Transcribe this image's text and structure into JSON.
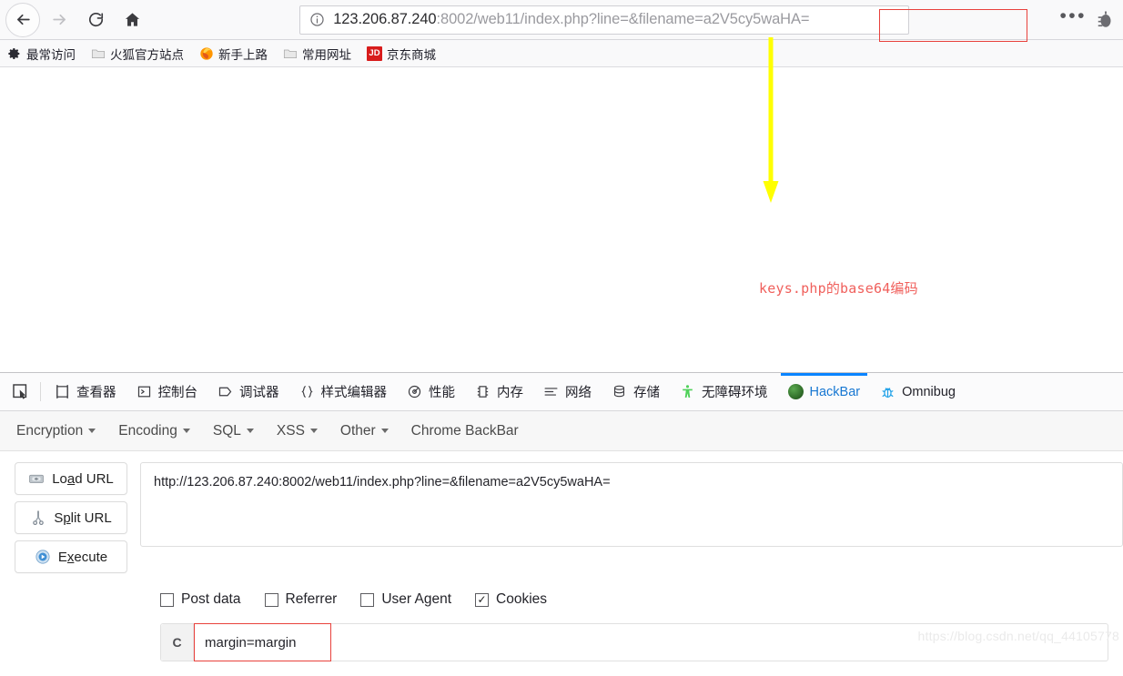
{
  "browser": {
    "nav": {
      "back_label": "Back",
      "forward_label": "Forward",
      "reload_label": "Reload",
      "home_label": "Home"
    },
    "url": {
      "host": "123.206.87.240",
      "path": ":8002/web11/index.php?line=&filename=",
      "highlighted": "a2V5cy5waHA=",
      "full": "123.206.87.240:8002/web11/index.php?line=&filename=a2V5cy5waHA="
    },
    "menu_label": "•••",
    "bookmarks": [
      {
        "label": "最常访问",
        "icon": "gear-icon"
      },
      {
        "label": "火狐官方站点",
        "icon": "folder-icon"
      },
      {
        "label": "新手上路",
        "icon": "firefox-icon"
      },
      {
        "label": "常用网址",
        "icon": "folder-icon"
      },
      {
        "label": "京东商城",
        "icon": "jd-icon",
        "badge": "JD"
      }
    ]
  },
  "annotation": {
    "text": "keys.php的base64编码",
    "color": "#f0605c",
    "arrow_color": "#ffff00"
  },
  "devtools": {
    "picker_label": "Element picker",
    "tabs": [
      {
        "label": "查看器",
        "icon": "inspector-icon",
        "active": false
      },
      {
        "label": "控制台",
        "icon": "console-icon",
        "active": false
      },
      {
        "label": "调试器",
        "icon": "debugger-icon",
        "active": false
      },
      {
        "label": "样式编辑器",
        "icon": "braces-icon",
        "active": false
      },
      {
        "label": "性能",
        "icon": "performance-icon",
        "active": false
      },
      {
        "label": "内存",
        "icon": "memory-icon",
        "active": false
      },
      {
        "label": "网络",
        "icon": "network-icon",
        "active": false
      },
      {
        "label": "存储",
        "icon": "storage-icon",
        "active": false
      },
      {
        "label": "无障碍环境",
        "icon": "accessibility-icon",
        "active": false
      },
      {
        "label": "HackBar",
        "icon": "hackbar-icon",
        "active": true
      },
      {
        "label": "Omnibug",
        "icon": "bug-icon",
        "active": false
      }
    ]
  },
  "hackbar": {
    "menus": [
      {
        "label": "Encryption",
        "has_caret": true
      },
      {
        "label": "Encoding",
        "has_caret": true
      },
      {
        "label": "SQL",
        "has_caret": true
      },
      {
        "label": "XSS",
        "has_caret": true
      },
      {
        "label": "Other",
        "has_caret": true
      },
      {
        "label": "Chrome BackBar",
        "has_caret": false
      }
    ],
    "buttons": [
      {
        "pre": "Lo",
        "key": "a",
        "post": "d URL",
        "icon": "load-url-icon"
      },
      {
        "pre": "S",
        "key": "p",
        "post": "lit URL",
        "icon": "split-url-icon"
      },
      {
        "pre": "E",
        "key": "x",
        "post": "ecute",
        "icon": "execute-icon"
      }
    ],
    "url_value": "http://123.206.87.240:8002/web11/index.php?line=&filename=a2V5cy5waHA=",
    "checkboxes": [
      {
        "label": "Post data",
        "checked": false
      },
      {
        "label": "Referrer",
        "checked": false
      },
      {
        "label": "User Agent",
        "checked": false
      },
      {
        "label": "Cookies",
        "checked": true
      }
    ],
    "cookie": {
      "prefix": "C",
      "value": "margin=margin"
    }
  },
  "watermark": "https://blog.csdn.net/qq_44105778"
}
